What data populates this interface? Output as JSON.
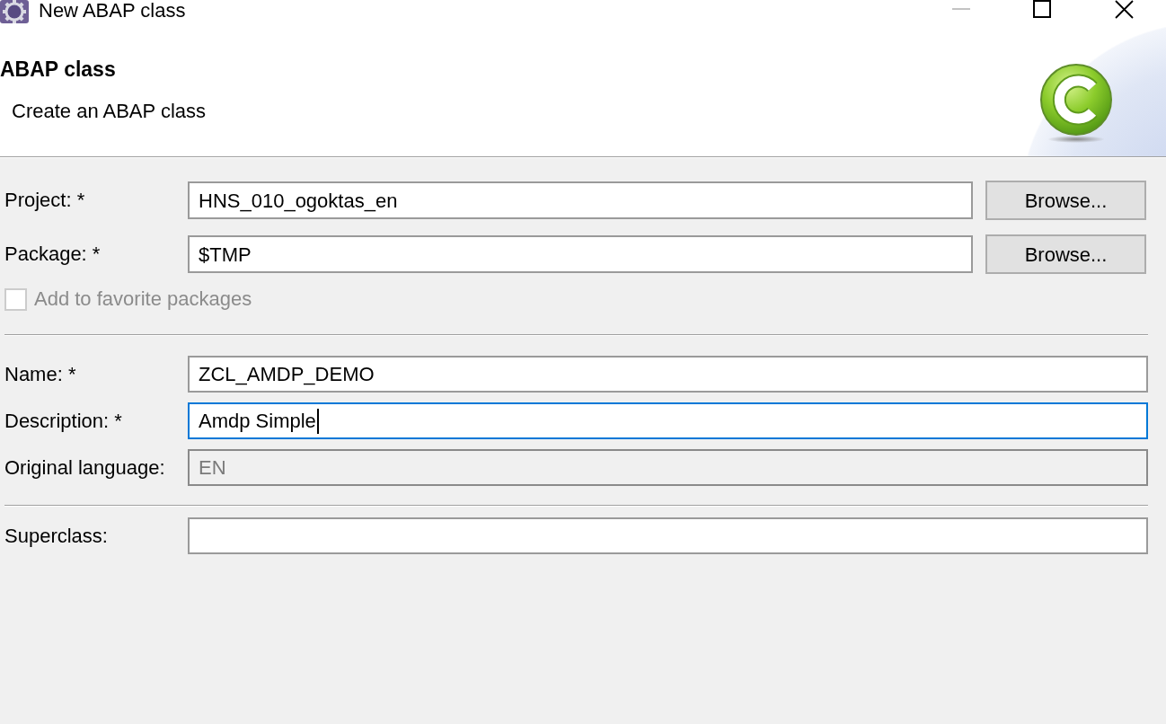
{
  "window": {
    "title": "New ABAP class"
  },
  "header": {
    "title": "ABAP class",
    "subtitle": "Create an ABAP class"
  },
  "sections": [
    {
      "rows": [
        {
          "kind": "field",
          "label": "Project: *",
          "value": "HNS_010_ogoktas_en",
          "button": "Browse...",
          "focused": false,
          "disabled": false
        },
        {
          "kind": "field",
          "label": "Package: *",
          "value": "$TMP",
          "button": "Browse...",
          "focused": false,
          "disabled": false
        },
        {
          "kind": "checkbox",
          "label": "Add to favorite packages",
          "checked": false,
          "disabled": true
        }
      ]
    },
    {
      "rows": [
        {
          "kind": "field",
          "label": "Name: *",
          "value": "ZCL_AMDP_DEMO",
          "focused": false,
          "disabled": false
        },
        {
          "kind": "field",
          "label": "Description: *",
          "value": "Amdp Simple",
          "focused": true,
          "disabled": false
        },
        {
          "kind": "field",
          "label": "Original language:",
          "value": "EN",
          "focused": false,
          "disabled": true
        }
      ]
    },
    {
      "rows": [
        {
          "kind": "field",
          "label": "Superclass:",
          "focused": false,
          "disabled": false
        }
      ]
    }
  ]
}
